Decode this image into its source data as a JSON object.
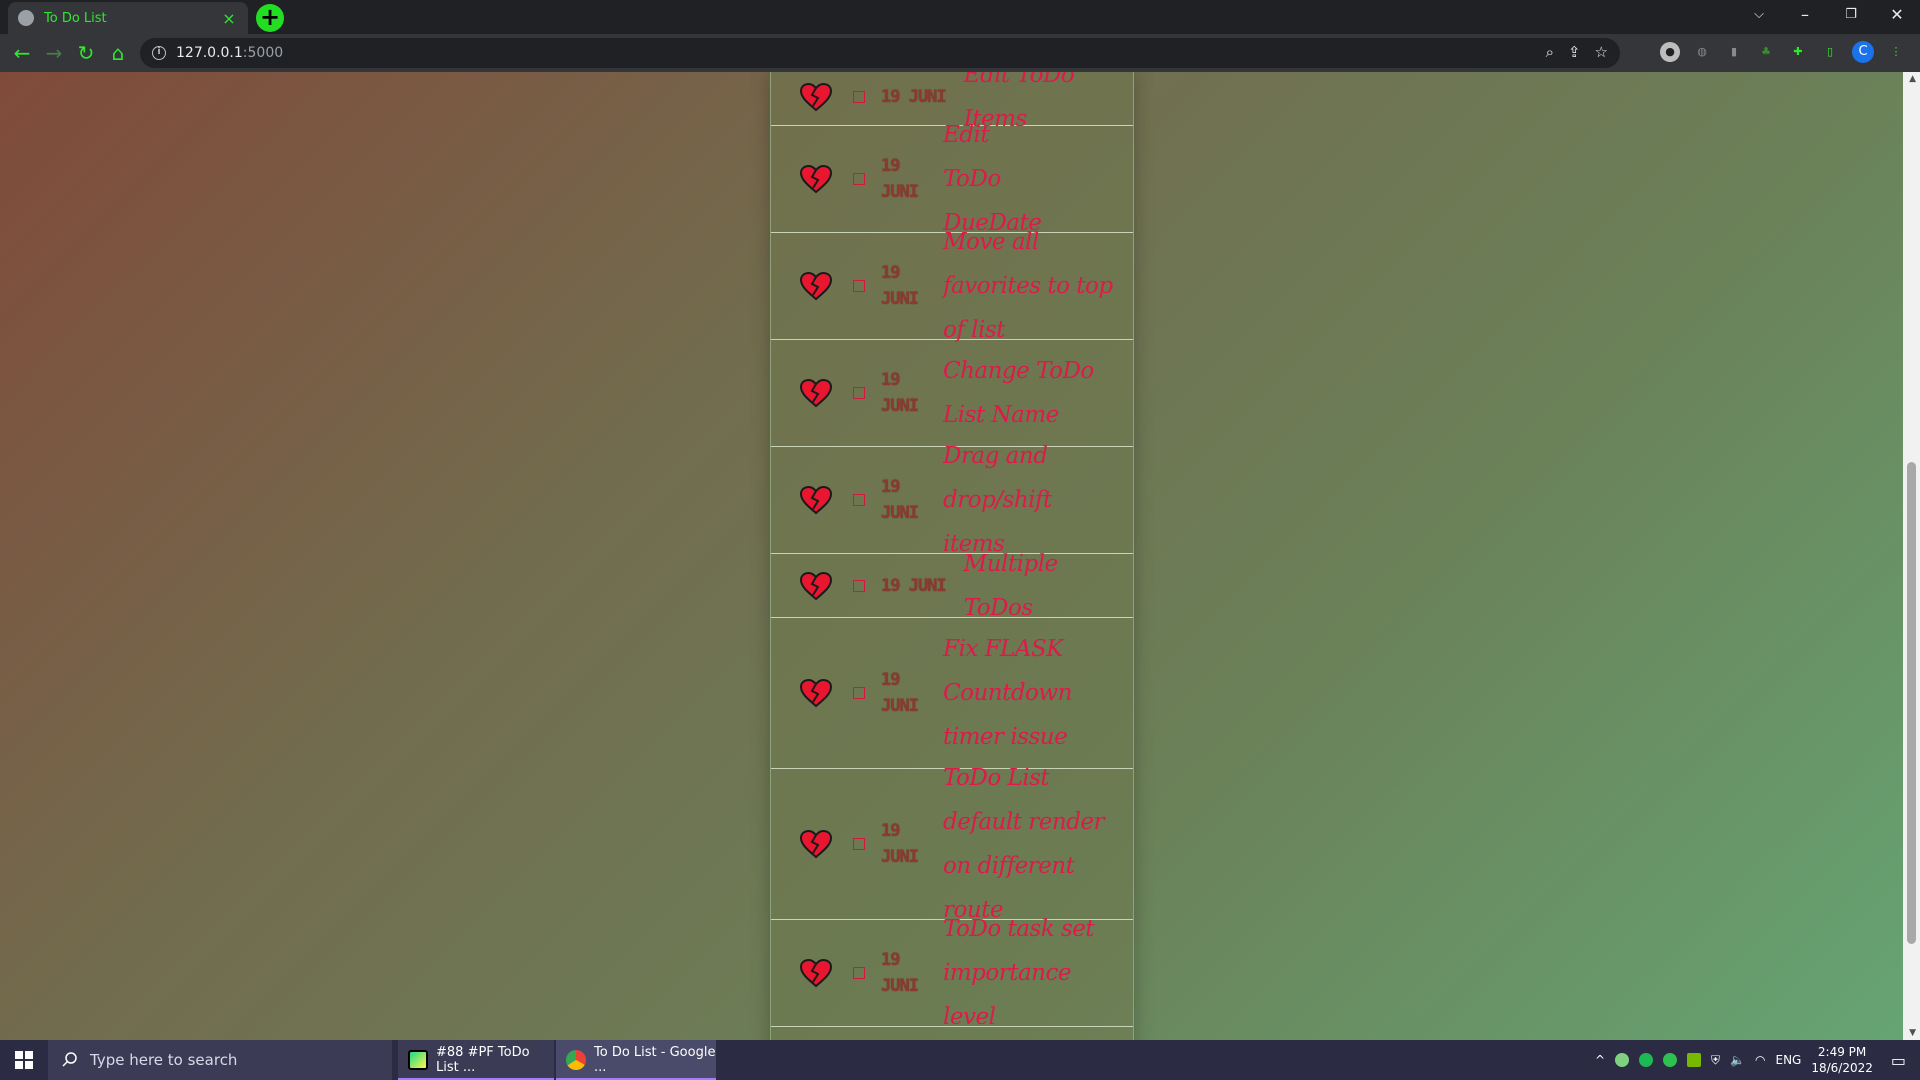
{
  "browser": {
    "tab_title": "To Do List",
    "tab_close": "×",
    "new_tab": "+",
    "url_host": "127.0.0.1",
    "url_port": ":5000",
    "profile_initial": "C"
  },
  "todos": [
    {
      "date": "19 JUNI",
      "text": "Edit ToDo Items"
    },
    {
      "date": "19 JUNI",
      "text": "Edit ToDo DueDate"
    },
    {
      "date": "19 JUNI",
      "text": "Move all favorites to top of list"
    },
    {
      "date": "19 JUNI",
      "text": "Change ToDo List Name"
    },
    {
      "date": "19 JUNI",
      "text": "Drag and drop/shift items"
    },
    {
      "date": "19 JUNI",
      "text": "Multiple ToDos"
    },
    {
      "date": "19 JUNI",
      "text": "Fix FLASK Countdown timer issue"
    },
    {
      "date": "19 JUNI",
      "text": "ToDo List default render on different route"
    },
    {
      "date": "19 JUNI",
      "text": "ToDo task set importance level"
    }
  ],
  "taskbar": {
    "search_placeholder": "Type here to search",
    "apps": [
      {
        "label": "#88 #PF ToDo List ...",
        "icon": "pycharm-icon"
      },
      {
        "label": "To Do List - Google ...",
        "icon": "chrome-icon"
      }
    ],
    "language": "ENG",
    "time": "2:49 PM",
    "date": "18/6/2022"
  },
  "colors": {
    "accent_green": "#2ee82e",
    "task_text": "#dd1a4a",
    "date_text": "#8c3a2e",
    "heart_red": "#e8172f"
  }
}
